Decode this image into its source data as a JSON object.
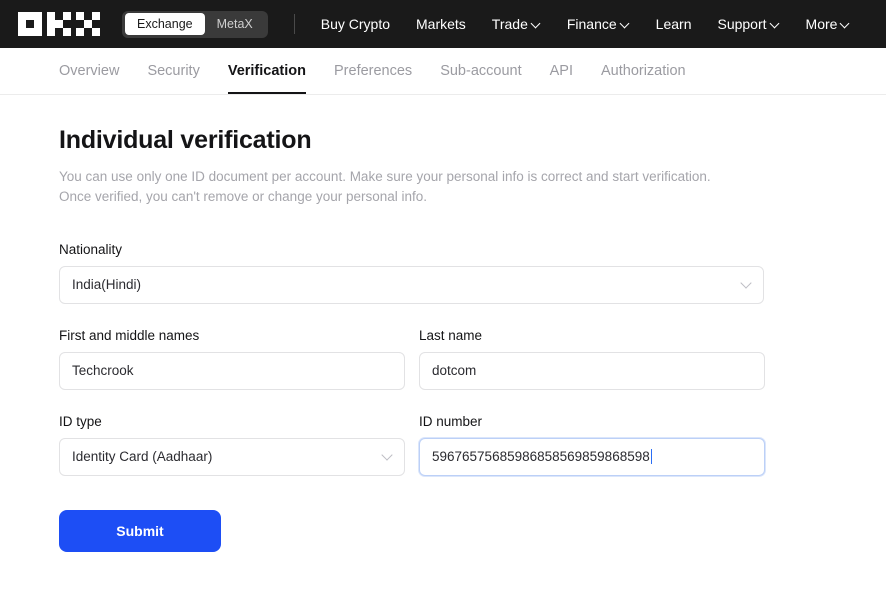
{
  "brand": {
    "logo_name": "okx-logo",
    "toggle": {
      "exchange_label": "Exchange",
      "metax_label": "MetaX",
      "active": "Exchange"
    }
  },
  "topnav": {
    "items": [
      {
        "label": "Buy Crypto",
        "has_caret": false
      },
      {
        "label": "Markets",
        "has_caret": false
      },
      {
        "label": "Trade",
        "has_caret": true
      },
      {
        "label": "Finance",
        "has_caret": true
      },
      {
        "label": "Learn",
        "has_caret": false
      },
      {
        "label": "Support",
        "has_caret": true
      },
      {
        "label": "More",
        "has_caret": true
      }
    ]
  },
  "tabs": {
    "items": [
      {
        "label": "Overview",
        "active": false
      },
      {
        "label": "Security",
        "active": false
      },
      {
        "label": "Verification",
        "active": true
      },
      {
        "label": "Preferences",
        "active": false
      },
      {
        "label": "Sub-account",
        "active": false
      },
      {
        "label": "API",
        "active": false
      },
      {
        "label": "Authorization",
        "active": false
      }
    ]
  },
  "page": {
    "title": "Individual verification",
    "description_line1": "You can use only one ID document per account. Make sure your personal info is correct and start verification.",
    "description_line2": "Once verified, you can't remove or change your personal info."
  },
  "form": {
    "nationality": {
      "label": "Nationality",
      "value": "India(Hindi)"
    },
    "first_name": {
      "label": "First and middle names",
      "value": "Techcrook"
    },
    "last_name": {
      "label": "Last name",
      "value": "dotcom"
    },
    "id_type": {
      "label": "ID type",
      "value": "Identity Card (Aadhaar)"
    },
    "id_number": {
      "label": "ID number",
      "value": "59676575685986858569859868598",
      "focused": true
    },
    "submit_label": "Submit"
  },
  "colors": {
    "header_bg": "#1a1a1a",
    "accent_blue": "#1d4ef5",
    "focus_border": "#bcd0f7",
    "muted_text": "#a5a5ab",
    "active_tab": "#141416"
  }
}
